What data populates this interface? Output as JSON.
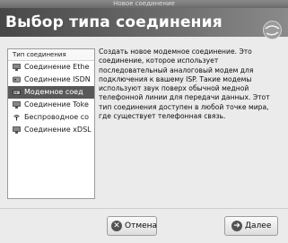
{
  "window": {
    "title": "Новое соединение"
  },
  "banner": {
    "title": "Выбор типа соединения"
  },
  "list": {
    "header": "Тип соединения",
    "items": [
      {
        "label": "Соединение Ethe",
        "icon": "ethernet-icon",
        "selected": false
      },
      {
        "label": "Соединение ISDN",
        "icon": "isdn-icon",
        "selected": false
      },
      {
        "label": "Модемное соед",
        "icon": "modem-icon",
        "selected": true
      },
      {
        "label": "Соединение Toke",
        "icon": "token-ring-icon",
        "selected": false
      },
      {
        "label": "Беспроводное со",
        "icon": "wireless-icon",
        "selected": false
      },
      {
        "label": "Соединение xDSL",
        "icon": "xdsl-icon",
        "selected": false
      }
    ]
  },
  "description": {
    "text": "Создать новое модемное соединение. Это соединение, которое использует последовательный аналоговый модем для подключения к вашему ISP. Такие модемы используют звук поверх обычной медной телефонной линии для передачи данных. Этот тип соединения доступен в любой точке мира, где существует телефонная связь."
  },
  "buttons": {
    "cancel_label": "Отмена",
    "next_label": "Далее"
  }
}
